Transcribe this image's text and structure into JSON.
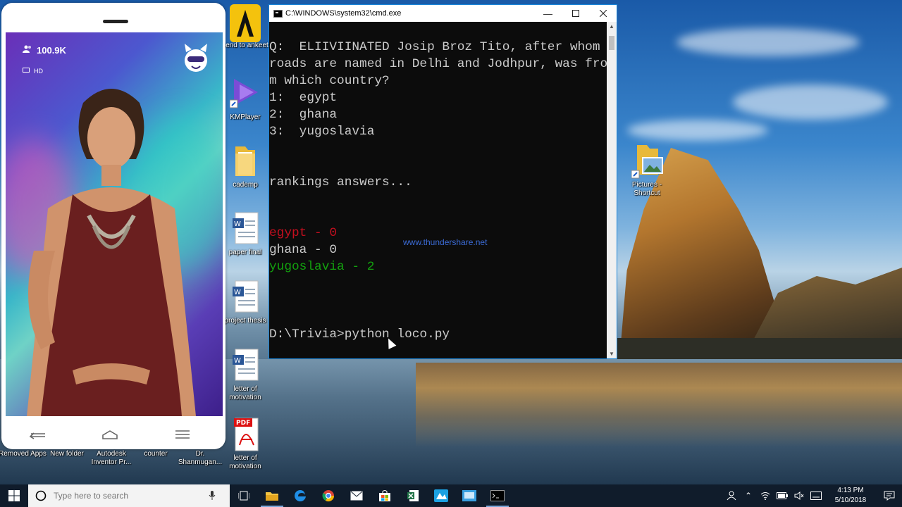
{
  "phone": {
    "viewer_count": "100.9K",
    "quality_label": "HD"
  },
  "desktop_icons": [
    {
      "label": "send to ankeet",
      "icon": "app-icon"
    },
    {
      "label": "KMPlayer",
      "icon": "kmplayer-icon"
    },
    {
      "label": "cademp",
      "icon": "folder-icon"
    },
    {
      "label": "paper final",
      "icon": "word-doc-icon"
    },
    {
      "label": "project thesis",
      "icon": "word-doc-icon"
    },
    {
      "label": "letter of motivation",
      "icon": "word-doc-icon"
    },
    {
      "label": "letter of motivation",
      "icon": "pdf-icon"
    },
    {
      "label": "Pictures - Shortcut",
      "icon": "pictures-shortcut-icon"
    },
    {
      "label": "Removed Apps",
      "icon": "folder-icon"
    },
    {
      "label": "New folder",
      "icon": "folder-icon"
    },
    {
      "label": "Autodesk Inventor Pr...",
      "icon": "app-icon"
    },
    {
      "label": "counter",
      "icon": "file-icon"
    },
    {
      "label": "Dr. Shanmugan...",
      "icon": "file-icon"
    }
  ],
  "cmd": {
    "title": "C:\\WINDOWS\\system32\\cmd.exe",
    "lines": [
      {
        "text": "Q:  ELIIVIINATED Josip Broz Tito, after whom",
        "color": "#cccccc"
      },
      {
        "text": "roads are named in Delhi and Jodhpur, was fro",
        "color": "#cccccc"
      },
      {
        "text": "m which country?",
        "color": "#cccccc"
      },
      {
        "text": "1:  egypt",
        "color": "#cccccc"
      },
      {
        "text": "2:  ghana",
        "color": "#cccccc"
      },
      {
        "text": "3:  yugoslavia",
        "color": "#cccccc"
      },
      {
        "text": "",
        "color": "#cccccc"
      },
      {
        "text": "",
        "color": "#cccccc"
      },
      {
        "text": "rankings answers...",
        "color": "#cccccc"
      },
      {
        "text": "",
        "color": "#cccccc"
      },
      {
        "text": "",
        "color": "#cccccc"
      },
      {
        "text": "egypt - 0",
        "color": "#c50f1f"
      },
      {
        "text": "ghana - 0",
        "color": "#cccccc"
      },
      {
        "text": "yugoslavia - 2",
        "color": "#13a10e"
      },
      {
        "text": "",
        "color": "#cccccc"
      },
      {
        "text": "",
        "color": "#cccccc"
      },
      {
        "text": "",
        "color": "#cccccc"
      },
      {
        "text": "D:\\Trivia>python loco.py",
        "color": "#cccccc"
      }
    ],
    "watermark": "www.thundershare.net"
  },
  "taskbar": {
    "search_placeholder": "Type here to search",
    "apps": [
      "task-view-icon",
      "file-explorer-icon",
      "edge-icon",
      "chrome-icon",
      "mail-icon",
      "store-icon",
      "excel-icon",
      "app-icon",
      "app-icon",
      "cmd-icon"
    ],
    "time": "4:13 PM",
    "date": "5/10/2018"
  }
}
